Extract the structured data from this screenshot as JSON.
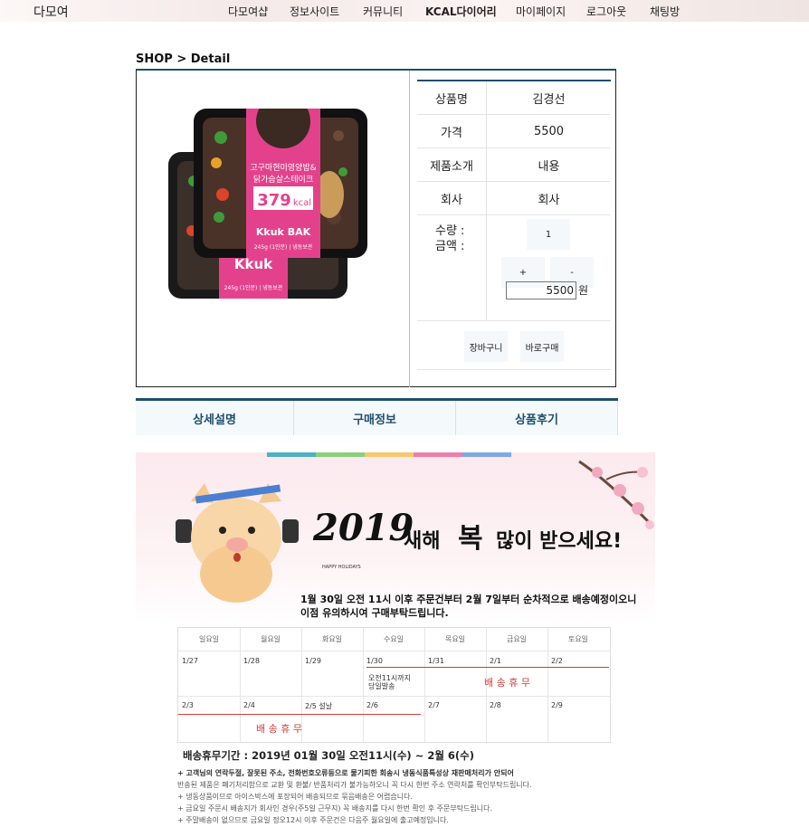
{
  "topnav": {
    "brand": "다모여",
    "items": [
      "다모여샵",
      "정보사이트",
      "커뮤니티",
      "KCAL다이어리",
      "마이페이지",
      "로그아웃",
      "채팅방"
    ]
  },
  "breadcrumb": "SHOP > Detail",
  "product": {
    "image_text": {
      "title1": "고구마현미영양밥&",
      "title2": "닭가슴살스테이크",
      "kcal": "379",
      "kcal_unit": "kcal",
      "brand": "Kkuk BAK",
      "weight": "245g (1인분) | 냉동보관"
    },
    "rows": [
      {
        "label": "상품명",
        "value": "김경선"
      },
      {
        "label": "가격",
        "value": "5500"
      },
      {
        "label": "제품소개",
        "value": "내용"
      },
      {
        "label": "회사",
        "value": "회사"
      }
    ],
    "qty_label": "수량 :",
    "amount_label": "금액 :",
    "quantity": "1",
    "plus_label": "+",
    "minus_label": "-",
    "amount_value": "5500",
    "amount_unit": "원",
    "cart_label": "장바구니",
    "buy_label": "바로구매"
  },
  "tabs": [
    "상세설명",
    "구매정보",
    "상품후기"
  ],
  "banner": {
    "year": "2019",
    "greeting_1": "새해",
    "greeting_2": "복",
    "greeting_3": "많이 받으세요!",
    "happy": "HAPPY HOLIDAYS",
    "notice1": "1월 30일 오전 11시 이후 주문건부터  2월 7일부터 순차적으로 배송예정이오니",
    "notice2": "이점 유의하시여 구매부탁드립니다.",
    "weekdays": [
      "일요일",
      "월요일",
      "화요일",
      "수요일",
      "목요일",
      "금요일",
      "토요일"
    ],
    "week1": [
      "1/27",
      "1/28",
      "1/29",
      "1/30",
      "1/31",
      "2/1",
      "2/2"
    ],
    "week2": [
      "2/3",
      "2/4",
      "2/5 설날",
      "2/6",
      "2/7",
      "2/8",
      "2/9"
    ],
    "note_1": "오전11시까지",
    "note_2": "당일발송",
    "holiday_label": "배 송 휴 무",
    "period": "배송휴무기간 : 2019년 01월 30일 오전11시(수) ~ 2월 6(수)",
    "bullets": [
      "+ 고객님의 연락두절, 잘못된 주소, 전화번호오류등으로 물기피한 회송시  냉동식품특성상 재판매처리가 안되어",
      "반송된 제품은 폐기처리함으로 교환 및 환불/ 반품처리가 불가능하오니 꼭 다시 한번 주소 연락처를 확인부탁드립니다.",
      "+ 냉동상품이므로 아이스박스에 포장되어 배송되므로 묶음배송은 어렵습니다.",
      "+ 금요일 주문시 배송지가 회사인 경우(주5일 근무지) 꼭 배송지를 다시 한번 확인 후 주문부탁드립니다.",
      "+ 주말배송이 없으므로 금요일 정오12시 이후 주문건은 다음주 월요일에 출고예정입니다."
    ]
  },
  "colors": {
    "accent": "#1f4e6e",
    "tab_bg": "#f4f9fb",
    "pink": "#e4418d",
    "holiday_red": "#d23b3b"
  }
}
